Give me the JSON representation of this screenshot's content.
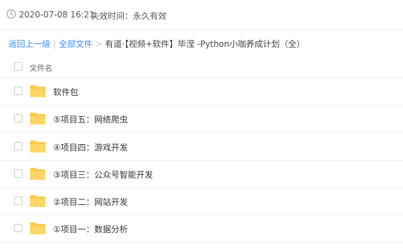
{
  "meta": {
    "date": "2020-07-08 16:21",
    "expire": "失效时间：永久有效"
  },
  "breadcrumb": {
    "back": "返回上一级",
    "all_files": "全部文件",
    "current": "有道·【视频+软件】毕滢 -Python小咖养成计划（全）"
  },
  "table": {
    "column_name": "文件名"
  },
  "files": [
    {
      "name": "软件包"
    },
    {
      "name": "⑤项目五：网络爬虫"
    },
    {
      "name": "④项目四：游戏开发"
    },
    {
      "name": "③项目三：公众号智能开发"
    },
    {
      "name": "②项目二：网站开发"
    },
    {
      "name": "①项目一：数据分析"
    }
  ],
  "colors": {
    "link": "#3b8cff",
    "folder": "#ffc94d"
  }
}
